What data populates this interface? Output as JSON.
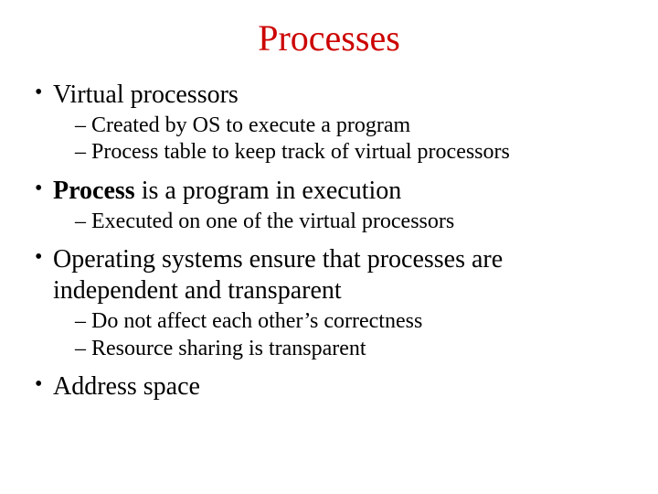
{
  "title": "Processes",
  "bullets": [
    {
      "segments": [
        {
          "text": "Virtual processors",
          "bold": false
        }
      ],
      "sub": [
        "Created by OS to execute a program",
        "Process table to keep track of virtual processors"
      ]
    },
    {
      "segments": [
        {
          "text": "Process",
          "bold": true
        },
        {
          "text": " is a program in execution",
          "bold": false
        }
      ],
      "sub": [
        "Executed on one of the virtual processors"
      ]
    },
    {
      "segments": [
        {
          "text": "Operating systems ensure that processes are independent and transparent",
          "bold": false
        }
      ],
      "sub": [
        "Do not affect each other’s correctness",
        "Resource sharing is transparent"
      ]
    },
    {
      "segments": [
        {
          "text": "Address space",
          "bold": false
        }
      ],
      "sub": []
    }
  ]
}
